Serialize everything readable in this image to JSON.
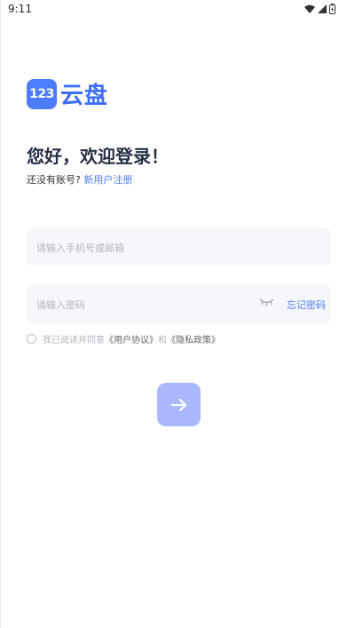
{
  "status_bar": {
    "time": "9:11"
  },
  "logo": {
    "mark": "123",
    "name": "云盘"
  },
  "welcome": "您好，欢迎登录！",
  "register": {
    "prompt": "还没有账号?",
    "link": "新用户注册"
  },
  "phone_field": {
    "placeholder": "请输入手机号或邮箱"
  },
  "password_field": {
    "placeholder": "请输入密码",
    "forgot": "忘记密码"
  },
  "agreement": {
    "prefix": "我已阅读并同意",
    "user_agreement": "《用户协议》",
    "and": "和",
    "privacy_policy": "《隐私政策》"
  },
  "icons": {
    "submit": "arrow-right-icon",
    "password_toggle": "eye-closed-icon"
  },
  "colors": {
    "accent": "#4d7cfe",
    "button_disabled": "#a8b9ff",
    "field_bg": "#f6f7fa"
  }
}
